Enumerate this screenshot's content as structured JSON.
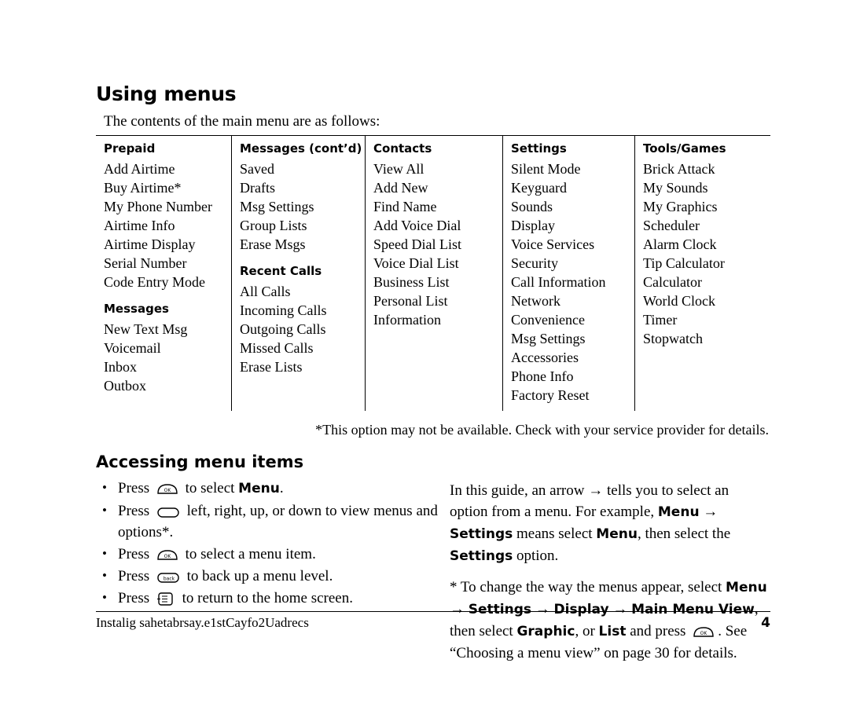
{
  "page": {
    "section_title": "Using menus",
    "intro": "The contents of the main menu are as follows:",
    "footnote": "*This option may not be available. Check with your service provider for details.",
    "sub_title": "Accessing menu items",
    "footer_text": "Instalig sahetabrsay.e1stCayfo2Uadrecs",
    "page_number": "4"
  },
  "menu_table": {
    "columns": [
      {
        "groups": [
          {
            "heading": "Prepaid",
            "items": [
              "Add Airtime",
              "Buy Airtime*",
              "My Phone Number",
              "Airtime Info",
              "Airtime Display",
              "Serial Number",
              "Code Entry Mode"
            ]
          },
          {
            "heading": "Messages",
            "items": [
              "New Text Msg",
              "Voicemail",
              "Inbox",
              "Outbox"
            ]
          }
        ]
      },
      {
        "groups": [
          {
            "heading": "Messages (cont’d)",
            "items": [
              "Saved",
              "Drafts",
              "Msg Settings",
              "Group Lists",
              "Erase Msgs"
            ]
          },
          {
            "heading": "Recent Calls",
            "items": [
              "All Calls",
              "Incoming Calls",
              "Outgoing Calls",
              "Missed Calls",
              "Erase Lists"
            ]
          }
        ]
      },
      {
        "groups": [
          {
            "heading": "Contacts",
            "items": [
              "View All",
              "Add New",
              "Find Name",
              "Add Voice Dial",
              "Speed Dial List",
              "Voice Dial List",
              "Business List",
              "Personal List",
              "Information"
            ]
          }
        ]
      },
      {
        "groups": [
          {
            "heading": "Settings",
            "items": [
              "Silent Mode",
              "Keyguard",
              "Sounds",
              "Display",
              "Voice Services",
              "Security",
              "Call Information",
              "Network",
              "Convenience",
              "Msg Settings",
              "Accessories",
              "Phone Info",
              "Factory Reset"
            ]
          }
        ]
      },
      {
        "groups": [
          {
            "heading": "Tools/Games",
            "items": [
              "Brick Attack",
              "My Sounds",
              "My Graphics",
              "Scheduler",
              "Alarm Clock",
              "Tip Calculator",
              "Calculator",
              "World Clock",
              "Timer",
              "Stopwatch"
            ]
          }
        ]
      }
    ]
  },
  "steps": {
    "items": [
      {
        "pre": "Press",
        "icon": "ok-key-icon",
        "post_plain": " to select ",
        "post_bold": "Menu",
        "post_tail": "."
      },
      {
        "pre": "Press",
        "icon": "navigation-key-icon",
        "post_plain": " left, right, up, or down to view menus and options*.",
        "post_bold": "",
        "post_tail": ""
      },
      {
        "pre": "Press",
        "icon": "ok-key-icon",
        "post_plain": " to select a menu item.",
        "post_bold": "",
        "post_tail": ""
      },
      {
        "pre": "Press",
        "icon": "back-key-icon",
        "post_plain": " to back up a menu level.",
        "post_bold": "",
        "post_tail": ""
      },
      {
        "pre": "Press",
        "icon": "end-key-icon",
        "post_plain": " to return to the home screen.",
        "post_bold": "",
        "post_tail": ""
      }
    ]
  },
  "right_text": {
    "p1_a": "In this guide, an arrow ",
    "p1_arrow": "→",
    "p1_b": " tells you to select an option from a menu. For example, ",
    "p1_menu": "Menu",
    "p1_arrow2": "→",
    "p1_settings": "Settings",
    "p1_c": " means select ",
    "p1_menu2": "Menu",
    "p1_d": ", then select the ",
    "p1_settings2": "Settings",
    "p1_e": " option.",
    "p2_a": "* To change the way the menus appear, select ",
    "p2_menu": "Menu",
    "p2_arrow1": "→",
    "p2_settings": "Settings",
    "p2_arrow2": "→",
    "p2_display": "Display",
    "p2_arrow3": "→",
    "p2_mainmenu": "Main Menu View",
    "p2_b": ", then select ",
    "p2_graphic": "Graphic",
    "p2_c": ", or ",
    "p2_list": "List",
    "p2_d": " and press ",
    "p2_e": ". See “Choosing a menu view” on page 30 for details."
  }
}
